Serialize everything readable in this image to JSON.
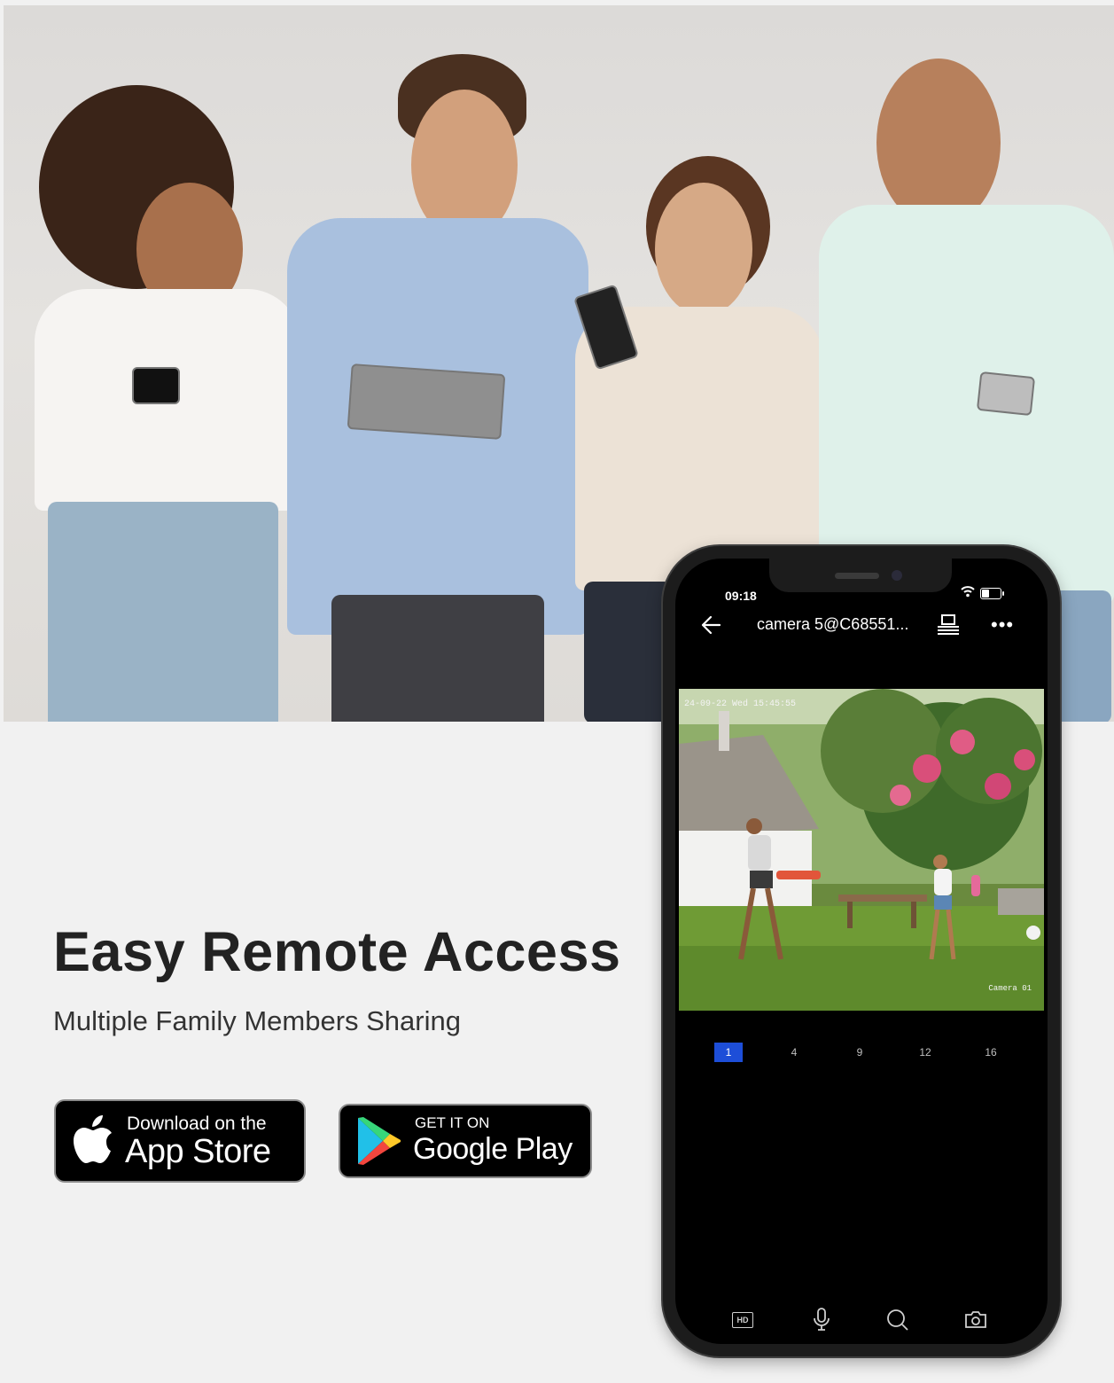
{
  "hero": {
    "headline": "Easy Remote Access",
    "subheadline": "Multiple Family Members Sharing"
  },
  "store_badges": {
    "app_store": {
      "line1": "Download on the",
      "line2": "App Store"
    },
    "google_play": {
      "line1": "GET IT ON",
      "line2": "Google Play"
    }
  },
  "phone": {
    "status": {
      "time": "09:18"
    },
    "header": {
      "title": "camera 5@C68551..."
    },
    "feed": {
      "timestamp": "24-09-22 Wed 15:45:55",
      "camera_label": "Camera 01"
    },
    "grid_options": [
      {
        "label": "1",
        "active": true
      },
      {
        "label": "4",
        "active": false
      },
      {
        "label": "9",
        "active": false
      },
      {
        "label": "12",
        "active": false
      },
      {
        "label": "16",
        "active": false
      }
    ],
    "toolbar": {
      "hd_label": "HD"
    }
  },
  "colors": {
    "accent": "#1d4ed8",
    "background": "#f1f1f1",
    "headline": "#222222"
  }
}
